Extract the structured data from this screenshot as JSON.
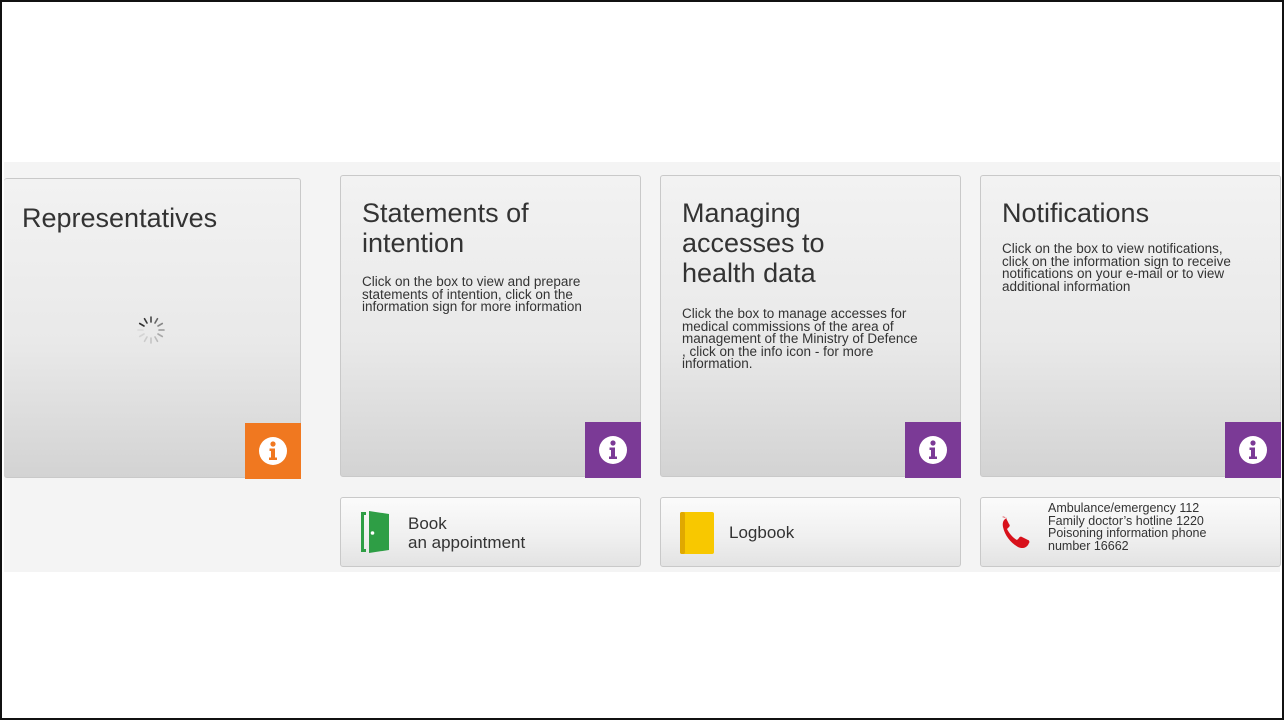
{
  "colors": {
    "info_orange": "#f07820",
    "info_purple": "#7b3a96",
    "door_green": "#2e9e45",
    "logbook_yellow": "#f8c800",
    "phone_red": "#d8111b"
  },
  "tiles": [
    {
      "title": "Representatives",
      "description": "",
      "info_icon": "info-icon",
      "info_color": "#f07820",
      "loading": true
    },
    {
      "title": "Statements of intention",
      "description": "Click on the box to view and prepare statements of intention, click on the information sign for more information",
      "info_icon": "info-icon",
      "info_color": "#7b3a96"
    },
    {
      "title": "Managing accesses to health data",
      "description": "Click the box to manage accesses for medical commissions of the area of management of the Ministry of Defence , click on the info icon - for more information.",
      "info_icon": "info-icon",
      "info_color": "#7b3a96"
    },
    {
      "title": "Notifications",
      "description": "Click on the box to view notifications, click on the information sign to receive notifications on your e-mail or to view additional information",
      "info_icon": "info-icon",
      "info_color": "#7b3a96"
    }
  ],
  "shortcuts": {
    "book": {
      "line1": "Book",
      "line2": "an appointment",
      "icon": "door-icon"
    },
    "logbook": {
      "label": "Logbook",
      "icon": "book-icon"
    },
    "emergency": {
      "icon": "phone-icon",
      "lines": [
        "Ambulance/emergency 112",
        "Family doctor’s hotline 1220",
        "Poisoning information phone",
        "number 16662"
      ]
    }
  }
}
